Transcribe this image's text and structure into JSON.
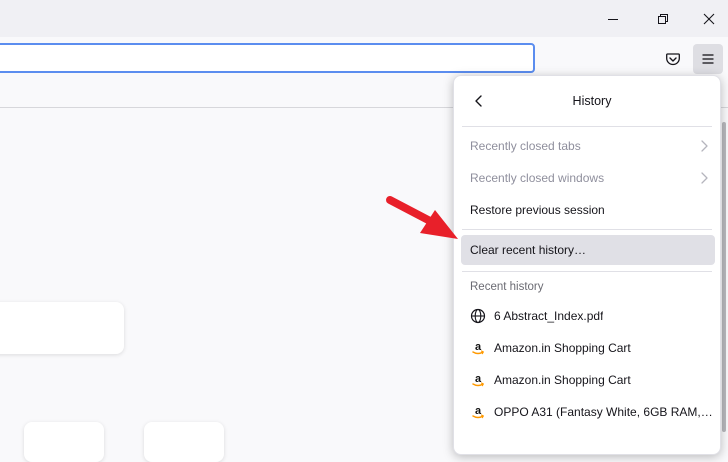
{
  "window": {
    "controls": [
      "restore-icon",
      "close-icon",
      "minimize-icon"
    ]
  },
  "toolbar": {
    "icons": [
      "pocket-icon",
      "hamburger-menu-icon"
    ]
  },
  "history_panel": {
    "title": "History",
    "items": [
      {
        "label": "Recently closed tabs",
        "enabled": false,
        "has_submenu": true
      },
      {
        "label": "Recently closed windows",
        "enabled": false,
        "has_submenu": true
      },
      {
        "label": "Restore previous session",
        "enabled": true,
        "has_submenu": false
      },
      {
        "label": "Clear recent history…",
        "enabled": true,
        "has_submenu": false,
        "highlighted": true
      }
    ],
    "recent_label": "Recent history",
    "recent": [
      {
        "label": "6 Abstract_Index.pdf",
        "icon": "globe-icon"
      },
      {
        "label": "Amazon.in Shopping Cart",
        "icon": "amazon-icon"
      },
      {
        "label": "Amazon.in Shopping Cart",
        "icon": "amazon-icon"
      },
      {
        "label": "OPPO A31 (Fantasy White, 6GB RAM, 1…",
        "icon": "amazon-icon"
      }
    ]
  },
  "annotation": {
    "arrow_color": "#e8202a"
  },
  "colors": {
    "focus_ring": "#5b8def",
    "hover_bg": "#e0e0e6"
  }
}
